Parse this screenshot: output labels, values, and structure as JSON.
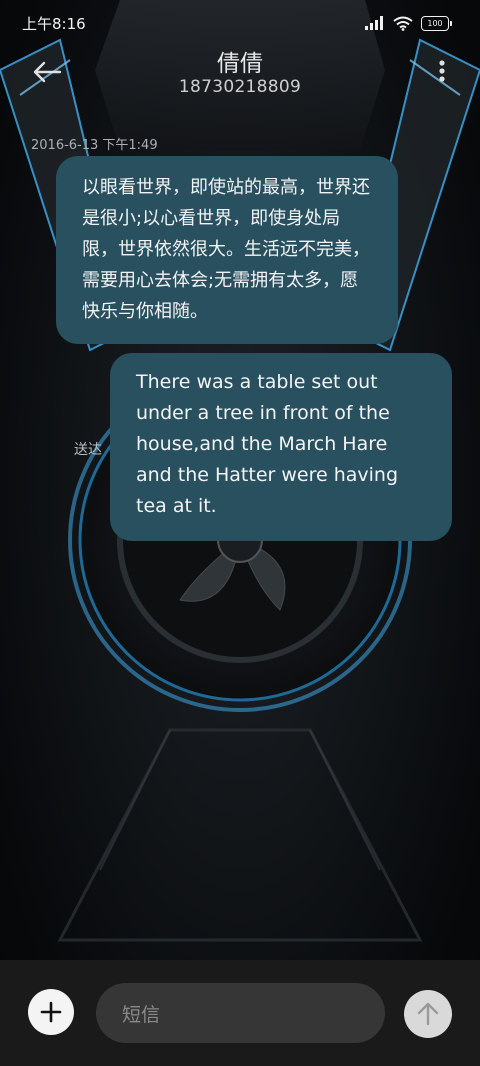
{
  "status_bar": {
    "time": "上午8:16",
    "battery": "100",
    "icons": [
      "signal-icon",
      "wifi-icon",
      "battery-icon"
    ]
  },
  "header": {
    "contact_name": "倩倩",
    "contact_number": "18730218809",
    "icons": [
      "back-arrow-icon",
      "more-options-icon"
    ]
  },
  "conversation": {
    "timestamp": "2016-6-13 下午1:49",
    "messages": [
      {
        "direction": "received",
        "text": "以眼看世界，即使站的最高，世界还是很小;以心看世界，即使身处局限，世界依然很大。生活远不完美，需要用心去体会;无需拥有太多，愿快乐与你相随。"
      },
      {
        "direction": "sent",
        "text": "There was a table set out under a tree in front of the house,and the March Hare and the Hatter were having tea at it.",
        "status": "送达"
      }
    ]
  },
  "input_bar": {
    "placeholder": "短信",
    "icons": [
      "plus-icon",
      "send-arrow-icon"
    ]
  },
  "colors": {
    "bubble": "#29505f",
    "input_bar": "#1a1a1a",
    "input_field": "#363636",
    "send_button": "#d9d9d9",
    "wallpaper_glow": "#3fa8e6"
  }
}
